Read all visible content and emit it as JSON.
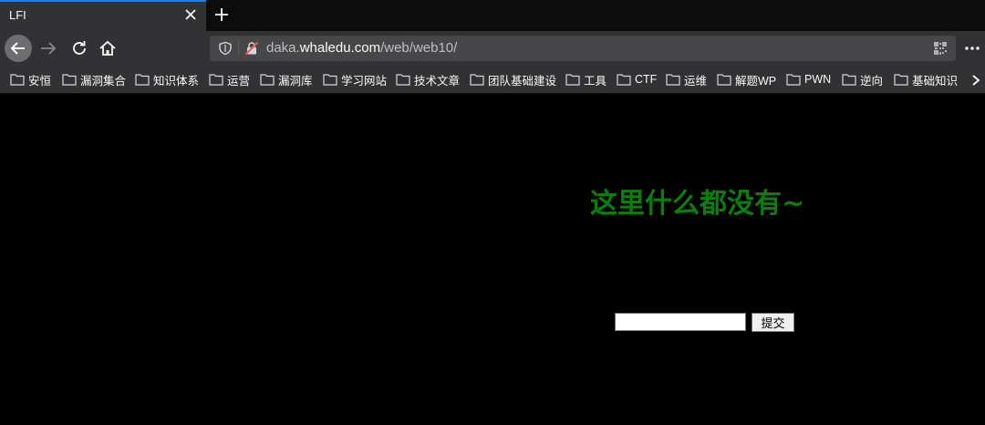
{
  "tab": {
    "title": "LFI"
  },
  "urlbar": {
    "prefix": "daka.",
    "host": "whaledu.com",
    "path": "/web/web10/"
  },
  "bookmarks": [
    "安恒",
    "漏洞集合",
    "知识体系",
    "运营",
    "漏洞库",
    "学习网站",
    "技术文章",
    "团队基础建设",
    "工具",
    "CTF",
    "运维",
    "解题WP",
    "PWN",
    "逆向",
    "基础知识"
  ],
  "page": {
    "heading": "这里什么都没有~",
    "input_value": "",
    "submit_label": "提交"
  },
  "colors": {
    "heading": "#0c7e0c",
    "tab_accent": "#0a84ff",
    "background": "#000000"
  },
  "icons": [
    "close-icon",
    "plus-icon",
    "back-arrow-icon",
    "forward-arrow-icon",
    "reload-icon",
    "home-icon",
    "shield-icon",
    "insecure-lock-icon",
    "qr-code-icon",
    "more-menu-icon",
    "folder-icon",
    "chevron-right-icon"
  ]
}
